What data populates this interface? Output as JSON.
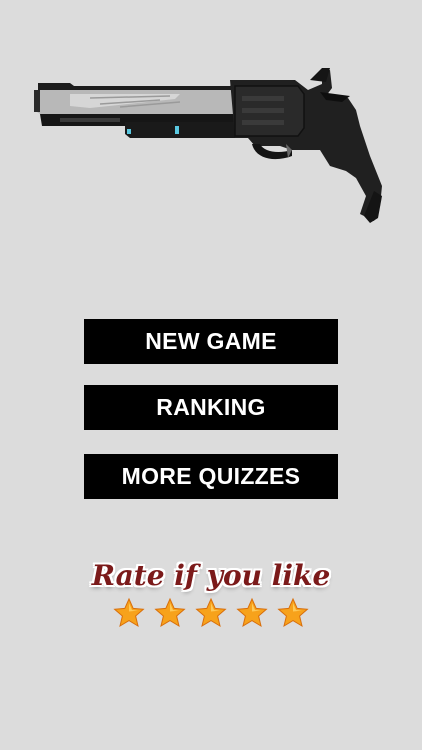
{
  "hero_image": {
    "icon": "revolver-icon"
  },
  "menu": {
    "new_game_label": "NEW GAME",
    "ranking_label": "RANKING",
    "more_quizzes_label": "MORE QUIZZES"
  },
  "rate": {
    "text": "Rate if you like",
    "star_count": 5,
    "star_color": "#f7a21b",
    "text_color": "#7b1a1a"
  },
  "colors": {
    "background": "#dcdcdc",
    "button_bg": "#000000",
    "button_text": "#ffffff"
  }
}
